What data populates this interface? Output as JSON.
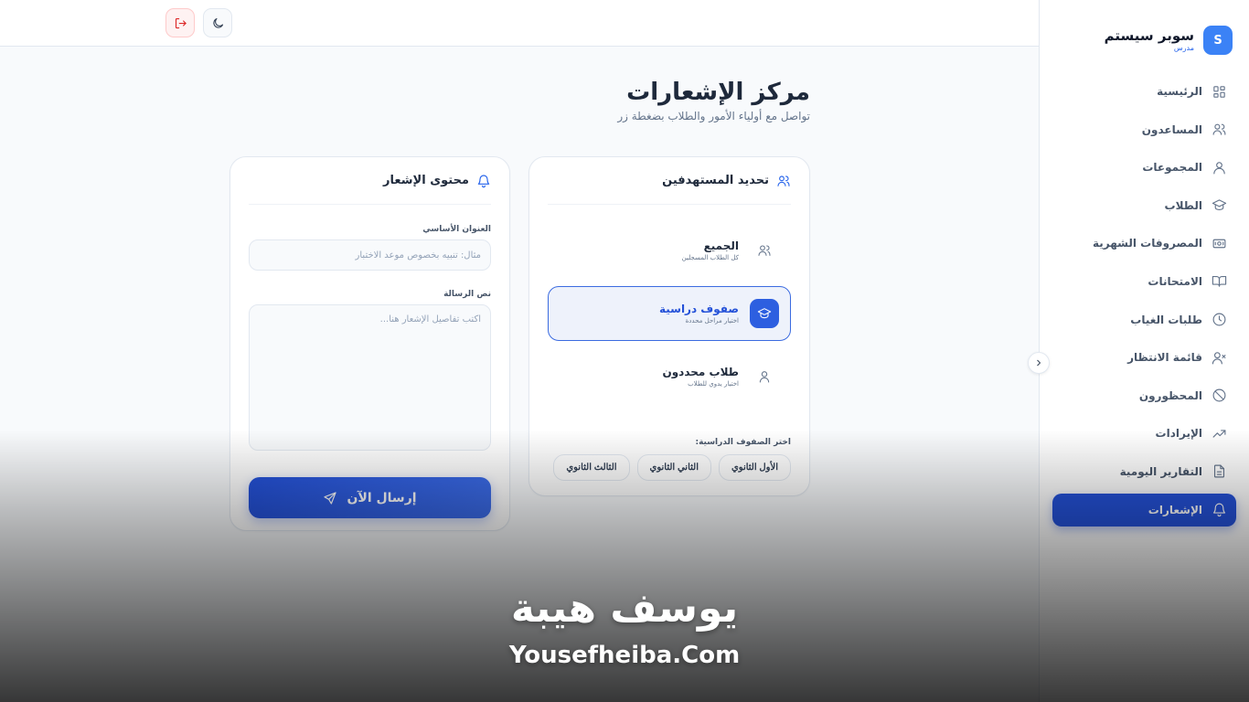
{
  "brand": {
    "logo_letter": "S",
    "name": "سوبر سيستم",
    "role": "مدرس",
    "accent": "#3b82f6"
  },
  "sidebar": {
    "items": [
      {
        "label": "الرئيسية",
        "icon": "dashboard-icon"
      },
      {
        "label": "المساعدون",
        "icon": "users-icon"
      },
      {
        "label": "المجموعات",
        "icon": "group-icon"
      },
      {
        "label": "الطلاب",
        "icon": "graduation-cap-icon"
      },
      {
        "label": "المصروفات الشهرية",
        "icon": "banknote-icon"
      },
      {
        "label": "الامتحانات",
        "icon": "book-open-icon"
      },
      {
        "label": "طلبات الغياب",
        "icon": "clock-icon"
      },
      {
        "label": "قائمة الانتظار",
        "icon": "user-x-icon"
      },
      {
        "label": "المحظورون",
        "icon": "ban-icon"
      },
      {
        "label": "الإيرادات",
        "icon": "trending-up-icon"
      },
      {
        "label": "التقارير اليومية",
        "icon": "file-text-icon"
      },
      {
        "label": "الإشعارات",
        "icon": "bell-icon",
        "active": true
      }
    ]
  },
  "header": {
    "logout_icon": "logout-icon",
    "theme_icon": "moon-icon"
  },
  "page": {
    "title": "مركز الإشعارات",
    "subtitle": "تواصل مع أولياء الأمور والطلاب بضغطة زر"
  },
  "targets": {
    "heading": "تحديد المستهدفين",
    "options": [
      {
        "title": "الجميع",
        "desc": "كل الطلاب المسجلين",
        "icon": "users-icon",
        "selected": false
      },
      {
        "title": "صفوف دراسية",
        "desc": "اختيار مراحل محددة",
        "icon": "graduation-cap-icon",
        "selected": true
      },
      {
        "title": "طلاب محددون",
        "desc": "اختيار يدوي للطلاب",
        "icon": "user-icon",
        "selected": false
      }
    ],
    "grades_label": "اختر الصفوف الدراسية:",
    "grades": [
      "الأول الثانوي",
      "الثاني الثانوي",
      "الثالث الثانوي"
    ]
  },
  "content": {
    "heading": "محتوى الإشعار",
    "title_label": "العنوان الأساسي",
    "title_placeholder": "مثال: تنبيه بخصوص موعد الاختبار",
    "title_value": "",
    "message_label": "نص الرسالة",
    "message_placeholder": "اكتب تفاصيل الإشعار هنا...",
    "message_value": "",
    "send_label": "إرسال الآن"
  },
  "watermark": {
    "arabic": "يوسف هيبة",
    "english": "Yousefheiba.Com"
  },
  "colors": {
    "primary": "#2451d8",
    "danger": "#dc2626",
    "background": "#f8fafc"
  }
}
